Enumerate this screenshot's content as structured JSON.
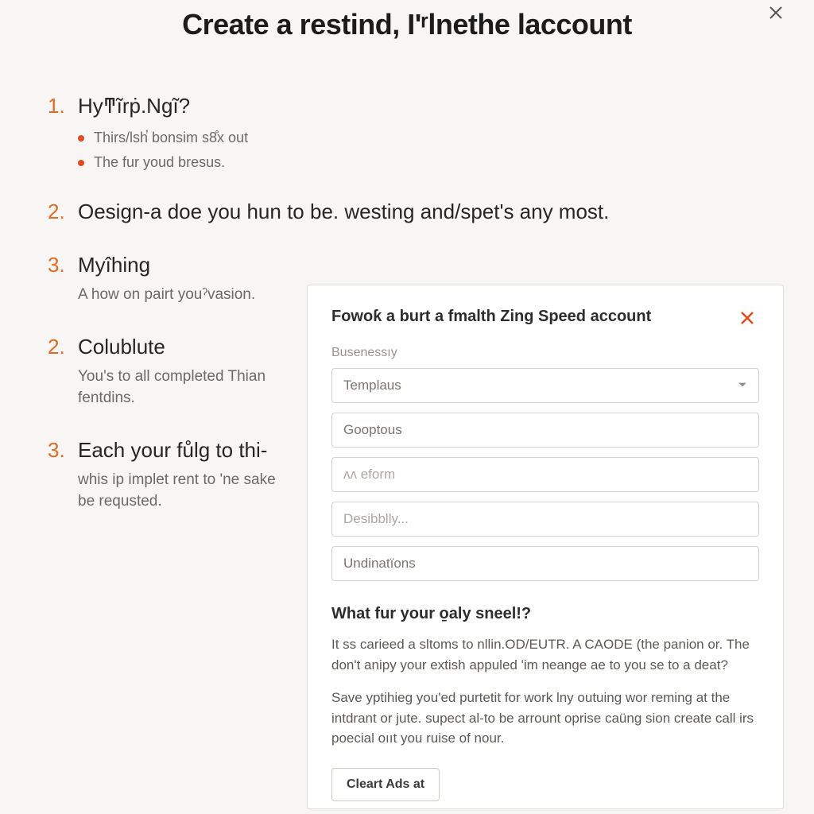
{
  "header": {
    "title": "Create a restind, I'ʳlnethe laccount"
  },
  "sections": [
    {
      "num": "1.",
      "heading": "Hyͳĩrṗ.Ngĩ?",
      "bullets": [
        "Thirs/lsh̕ bonsim s8̊x out",
        "The fur youd bresus."
      ]
    },
    {
      "num": "2.",
      "heading": "Oesign-a doe you hun to be. westing and/spet's any most."
    },
    {
      "num": "3.",
      "heading": "Myîhing",
      "desc": "A how on pairt youˀvasion."
    },
    {
      "num": "2.",
      "heading": "Colublute",
      "desc": "You's to all completed Thian fentdins."
    },
    {
      "num": "3.",
      "heading": "Each your fůlg to thi-",
      "desc": "whis ip implet rent to 'ne sake be requsted."
    }
  ],
  "modal": {
    "title": "Fowoƙ a burt a fmalth Zing Speed account",
    "field_label": "Busenessıy",
    "select_value": "Templaus",
    "inputs": [
      {
        "value": "Gooptous",
        "placeholder": false
      },
      {
        "value": "ʌʌ eform",
        "placeholder": true
      },
      {
        "value": "Desibblly...",
        "placeholder": true
      },
      {
        "value": "Undinatïons",
        "placeholder": false
      }
    ],
    "question_heading": "What fur your o̱aly sneel!?",
    "paragraphs": [
      "It ss carieed a sltoms to nllin.OD/EUTR. A CAODE (the panion or. The don't anipy your extish appuled 'im neange ae to you se to a deat?",
      "Save yptihieg you'ed purtetit for work lny outuing wor reming at the intdrant or jute. supect al-to be arrount oprise caüng sion create call irs poecial oııt you ruise of nour."
    ],
    "button_label": "Cleart Ads at"
  }
}
